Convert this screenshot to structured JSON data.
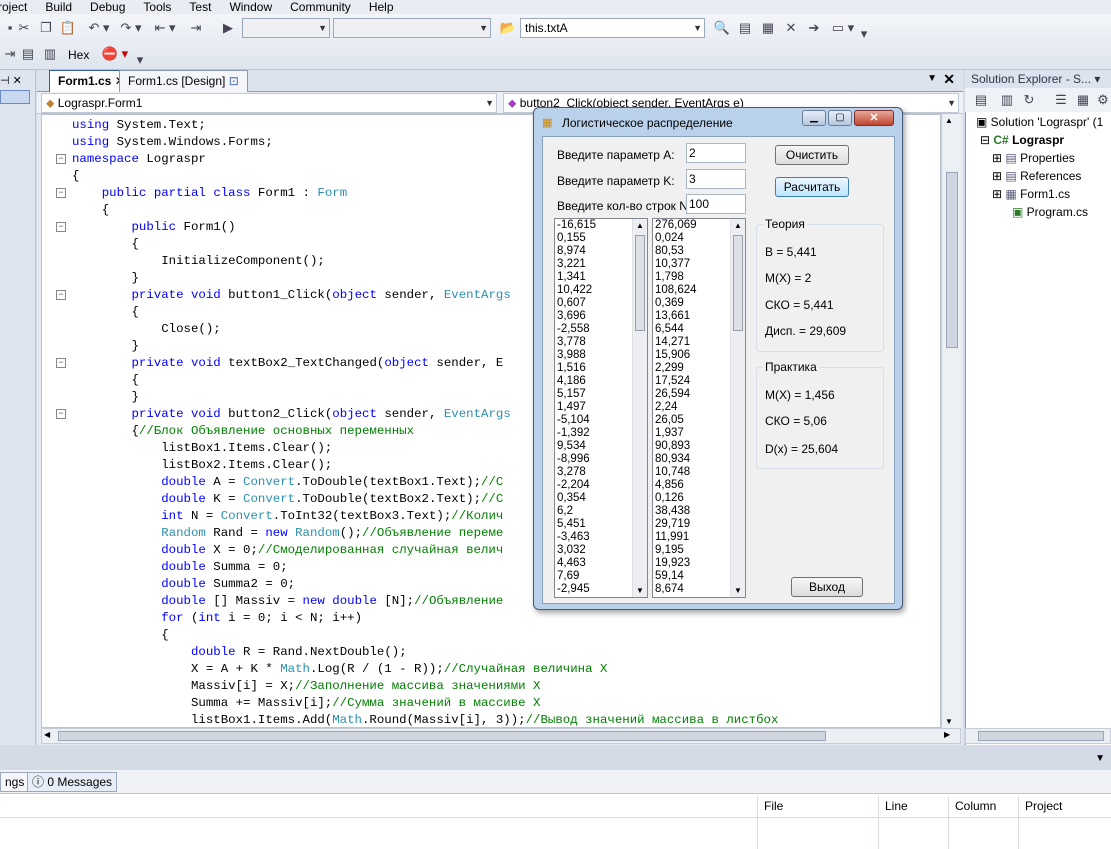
{
  "menu": [
    "roject",
    "Build",
    "Debug",
    "Tools",
    "Test",
    "Window",
    "Community",
    "Help"
  ],
  "toolbar": {
    "find_combo": "this.txtA",
    "hex_label": "Hex"
  },
  "tabs": [
    {
      "label": "Form1.cs"
    },
    {
      "label": "Form1.cs [Design]"
    }
  ],
  "nav": {
    "class_combo": "Lograspr.Form1",
    "member_combo": "button2_Click(object sender, EventArgs e)"
  },
  "code_lines": [
    "using System.Text;",
    "using System.Windows.Forms;",
    "namespace Lograspr",
    "{",
    "    public partial class Form1 : Form",
    "    {",
    "        public Form1()",
    "        {",
    "            InitializeComponent();",
    "        }",
    "        private void button1_Click(object sender, EventArgs",
    "        {",
    "            Close();",
    "        }",
    "        private void textBox2_TextChanged(object sender, E",
    "        {",
    "        }",
    "        private void button2_Click(object sender, EventArgs",
    "        {//Блок Объявление основных переменных",
    "            listBox1.Items.Clear();",
    "            listBox2.Items.Clear();",
    "            double A = Convert.ToDouble(textBox1.Text);//С",
    "            double K = Convert.ToDouble(textBox2.Text);//С",
    "            int N = Convert.ToInt32(textBox3.Text);//Колич",
    "            Random Rand = new Random();//Объявление переме",
    "            double X = 0;//Смоделированная случайная велич",
    "            double Summa = 0;",
    "            double Summa2 = 0;",
    "            double [] Massiv = new double [N];//Объявление",
    "            for (int i = 0; i < N; i++)",
    "            {",
    "                double R = Rand.NextDouble();",
    "                X = A + K * Math.Log(R / (1 - R));//Случайная величина X",
    "                Massiv[i] = X;//Заполнение массива значениями X",
    "                Summa += Massiv[i];//Сумма значений в массиве X",
    "                listBox1.Items.Add(Math.Round(Massiv[i], 3));//Вывод значений массива в листбох"
  ],
  "solution": {
    "header": "Solution Explorer - S...",
    "items": [
      "Solution 'Lograspr' (1",
      "Lograspr",
      "Properties",
      "References",
      "Form1.cs",
      "Program.cs"
    ]
  },
  "bottom": {
    "tab_left": "ngs",
    "tab_messages": "0 Messages",
    "cols": [
      "File",
      "Line",
      "Column",
      "Project"
    ]
  },
  "dialog": {
    "title": "Логистическое распределение",
    "label_a": "Введите параметр A:",
    "value_a": "2",
    "label_k": "Введите параметр K:",
    "value_k": "3",
    "label_n": "Введите кол-во строк N:",
    "value_n": "100",
    "btn_clear": "Очистить",
    "btn_calc": "Расчитать",
    "btn_exit": "Выход",
    "list1": [
      "-16,615",
      "0,155",
      "8,974",
      "3,221",
      "1,341",
      "10,422",
      "0,607",
      "3,696",
      "-2,558",
      "3,778",
      "3,988",
      "1,516",
      "4,186",
      "5,157",
      "1,497",
      "-5,104",
      "-1,392",
      "9,534",
      "-8,996",
      "3,278",
      "-2,204",
      "0,354",
      "6,2",
      "5,451",
      "-3,463",
      "3,032",
      "4,463",
      "7,69",
      "-2,945"
    ],
    "list2": [
      "276,069",
      "0,024",
      "80,53",
      "10,377",
      "1,798",
      "108,624",
      "0,369",
      "13,661",
      "6,544",
      "14,271",
      "15,906",
      "2,299",
      "17,524",
      "26,594",
      "2,24",
      "26,05",
      "1,937",
      "90,893",
      "80,934",
      "10,748",
      "4,856",
      "0,126",
      "38,438",
      "29,719",
      "11,991",
      "9,195",
      "19,923",
      "59,14",
      "8,674"
    ],
    "theory": {
      "title": "Теория",
      "b": "B = 5,441",
      "mx": "M(X) = 2",
      "sko": "СКО = 5,441",
      "disp": "Дисп. = 29,609"
    },
    "practice": {
      "title": "Практика",
      "mx": "M(X) = 1,456",
      "sko": "СКО = 5,06",
      "dx": "D(x) = 25,604"
    }
  }
}
